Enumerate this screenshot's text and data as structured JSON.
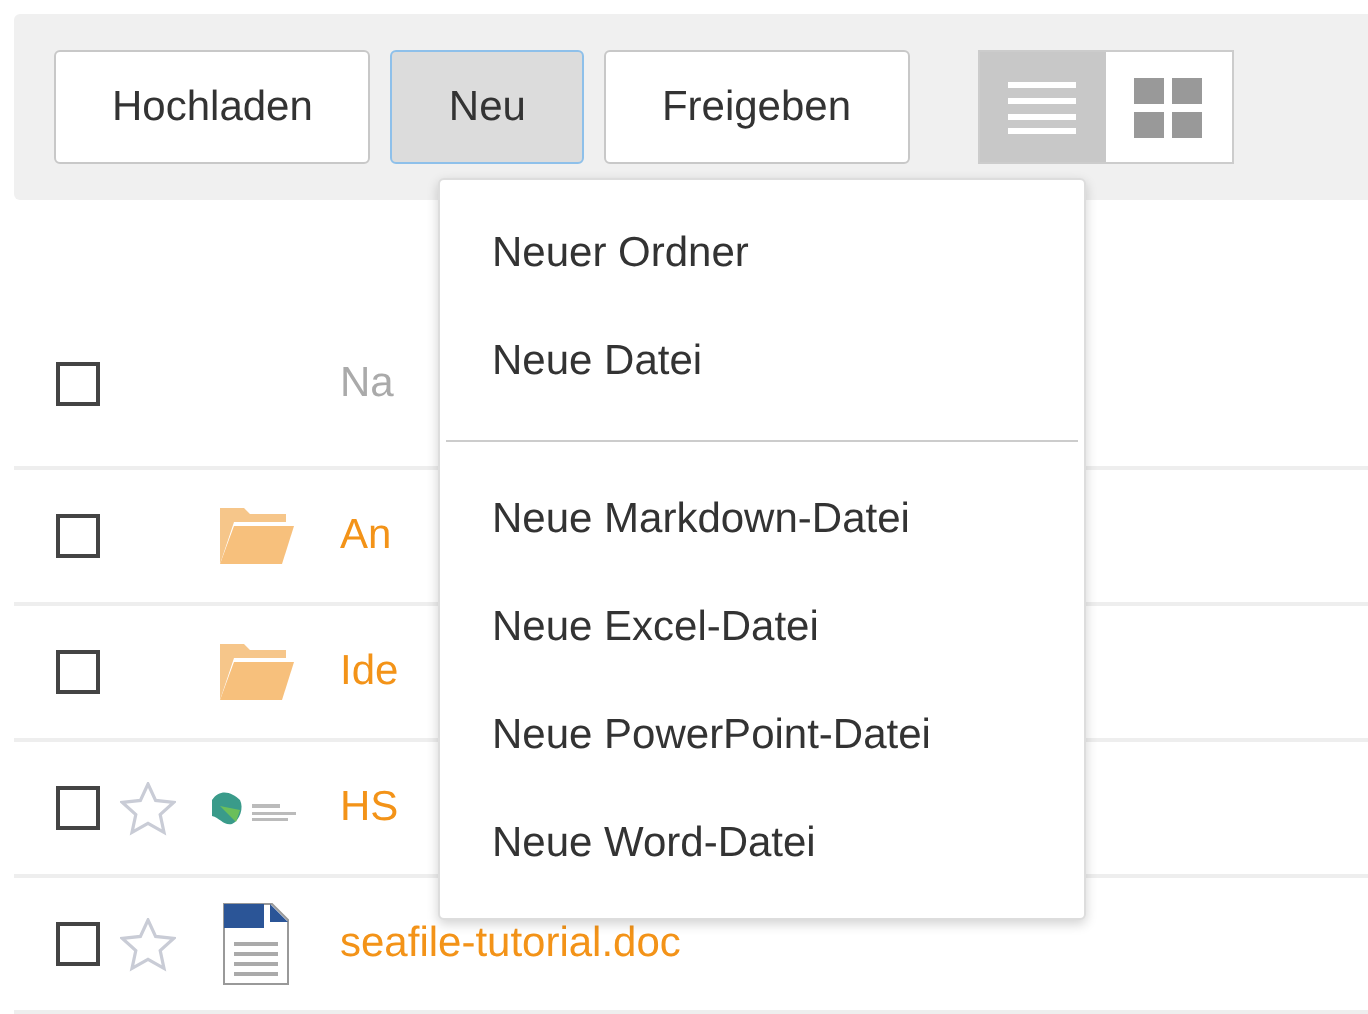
{
  "toolbar": {
    "buttons": [
      {
        "label": "Hochladen",
        "selected": false
      },
      {
        "label": "Neu",
        "selected": true
      },
      {
        "label": "Freigeben",
        "selected": false
      }
    ],
    "views": [
      {
        "kind": "list",
        "selected": true
      },
      {
        "kind": "grid",
        "selected": false
      }
    ]
  },
  "dropdown": {
    "groups": [
      [
        "Neuer Ordner",
        "Neue Datei"
      ],
      [
        "Neue Markdown-Datei",
        "Neue Excel-Datei",
        "Neue PowerPoint-Datei",
        "Neue Word-Datei"
      ]
    ]
  },
  "table": {
    "header": {
      "checked": false,
      "label": "Na"
    },
    "rows": [
      {
        "kind": "folder",
        "checked": false,
        "name": "An"
      },
      {
        "kind": "folder",
        "checked": false,
        "name": "Ide"
      },
      {
        "kind": "image",
        "checked": false,
        "starred": false,
        "name": "HS"
      },
      {
        "kind": "document",
        "checked": false,
        "starred": false,
        "name": "seafile-tutorial.doc"
      }
    ]
  }
}
